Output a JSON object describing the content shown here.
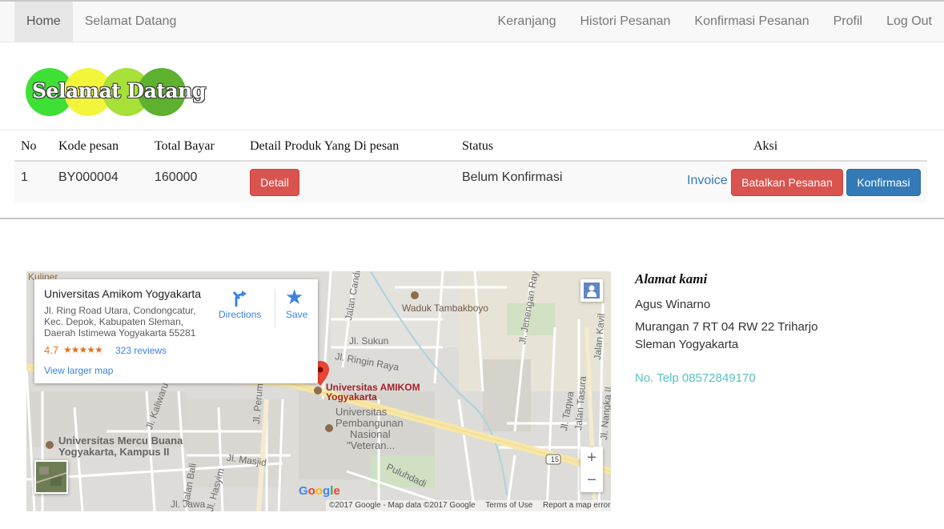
{
  "nav": {
    "left": [
      {
        "label": "Home",
        "active": true
      },
      {
        "label": "Selamat Datang",
        "active": false
      }
    ],
    "right": [
      {
        "label": "Keranjang"
      },
      {
        "label": "Histori Pesanan"
      },
      {
        "label": "Konfirmasi Pesanan"
      },
      {
        "label": "Profil"
      },
      {
        "label": "Log Out"
      }
    ]
  },
  "logo": {
    "text": "Selamat Datang",
    "circle_colors": [
      "#3ee036",
      "#f2f53a",
      "#a8e03a",
      "#5db12f"
    ]
  },
  "table": {
    "headers": [
      "No",
      "Kode pesan",
      "Total Bayar",
      "Detail Produk Yang Di pesan",
      "Status",
      "Aksi"
    ],
    "rows": [
      {
        "no": "1",
        "kode": "BY000004",
        "total": "160000",
        "detail_button": "Detail",
        "status": "Belum Konfirmasi",
        "invoice_link": "Invoice",
        "cancel_button": "Batalkan Pesanan",
        "confirm_button": "Konfirmasi"
      }
    ]
  },
  "map": {
    "place": {
      "name": "Universitas Amikom Yogyakarta",
      "address": "Jl. Ring Road Utara, Condongcatur, Kec. Depok, Kabupaten Sleman, Daerah Istimewa Yogyakarta 55281",
      "rating": "4.7",
      "stars": "★★★★★",
      "reviews": "323 reviews",
      "directions": "Directions",
      "save": "Save",
      "larger_map": "View larger map"
    },
    "labels": {
      "kuliner": "Kuliner",
      "waduk": "Waduk Tambakboyo",
      "amikom_line1": "Universitas AMIKOM",
      "amikom_line2": "Yogyakarta",
      "upn_line1": "Universitas",
      "upn_line2": "Pembangunan",
      "upn_line3": "Nasional",
      "upn_line4": "\"Veteran...",
      "mercu_line1": "Universitas Mercu Buana",
      "mercu_line2": "Yogyakarta, Kampus II",
      "jl_sukun": "Jl. Sukun",
      "jl_ringin": "Jl. Ringin Raya",
      "jl_masjid": "Jl. Masjid",
      "jl_perumnas": "Jl. Perumnas",
      "jl_candi": "Jalan Candi",
      "jl_jenengan": "Jl. Jenengan Raya",
      "jl_taqwa": "Jl. Taqwa",
      "jl_tasura": "Jalan Tasura",
      "jl_nangka": "Jl. Nangka II",
      "jl_kalwaru": "Jl. Kaliwaru",
      "jl_puluhdadi": "Puluhdadi",
      "jl_bali": "Jalan Bali",
      "jl_hasyim": "Jl. Hasyim",
      "jl_jawa": "Jl. Jawa",
      "jl_kavil": "Jalan Kavil",
      "route": "15"
    },
    "zoom_in": "+",
    "zoom_out": "−",
    "google": "Google",
    "attribution": [
      "©2017 Google - Map data ©2017 Google",
      "Terms of Use",
      "Report a map error"
    ]
  },
  "address": {
    "title": "Alamat kami",
    "name": "Agus Winarno",
    "line1": "Murangan 7 RT 04 RW 22 Triharjo",
    "line2": "Sleman Yogyakarta",
    "phone": "No. Telp 08572849170"
  }
}
